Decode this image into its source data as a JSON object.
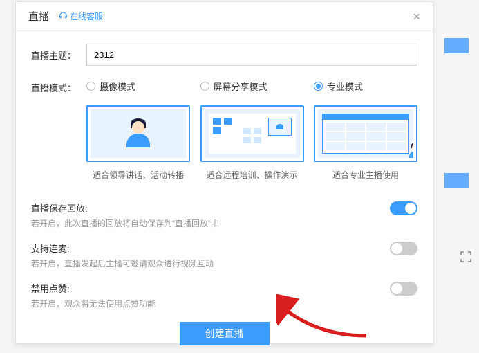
{
  "header": {
    "title": "直播",
    "support": "在线客服"
  },
  "form": {
    "subject_label": "直播主题：",
    "subject_value": "2312",
    "mode_label": "直播模式：",
    "modes": [
      {
        "label": "摄像模式",
        "desc": "适合领导讲话、活动转播",
        "checked": false
      },
      {
        "label": "屏幕分享模式",
        "desc": "适合远程培训、操作演示",
        "checked": false
      },
      {
        "label": "专业模式",
        "desc": "适合专业主播使用",
        "checked": true
      }
    ]
  },
  "toggles": [
    {
      "title": "直播保存回放:",
      "desc": "若开启，此次直播的回放将自动保存到“直播回放”中",
      "on": true
    },
    {
      "title": "支持连麦:",
      "desc": "若开启，直播发起后主播可邀请观众进行视频互动",
      "on": false
    },
    {
      "title": "禁用点赞:",
      "desc": "若开启，观众将无法使用点赞功能",
      "on": false
    }
  ],
  "button": {
    "create": "创建直播"
  }
}
